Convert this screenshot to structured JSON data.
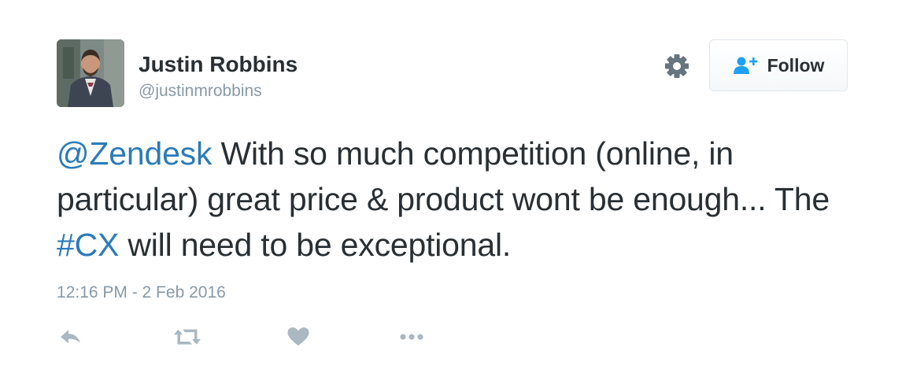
{
  "user": {
    "display_name": "Justin Robbins",
    "handle": "@justinmrobbins"
  },
  "follow_button": {
    "label": "Follow"
  },
  "tweet": {
    "mention": "@Zendesk",
    "text_1": " With so much competition (online, in particular) great price & product wont be enough... The ",
    "hashtag": "#CX",
    "text_2": " will need to be exceptional.",
    "timestamp": "12:16 PM - 2 Feb 2016"
  },
  "actions": [
    "reply-icon",
    "retweet-icon",
    "like-icon",
    "more-icon"
  ],
  "icons": {
    "settings": "gear-icon",
    "follow": "follow-user-icon"
  },
  "colors": {
    "link": "#2b7bb9",
    "text": "#292f33",
    "muted": "#8899a6",
    "action_icons": "#aab8c2",
    "follow_icon": "#1da1f2"
  }
}
